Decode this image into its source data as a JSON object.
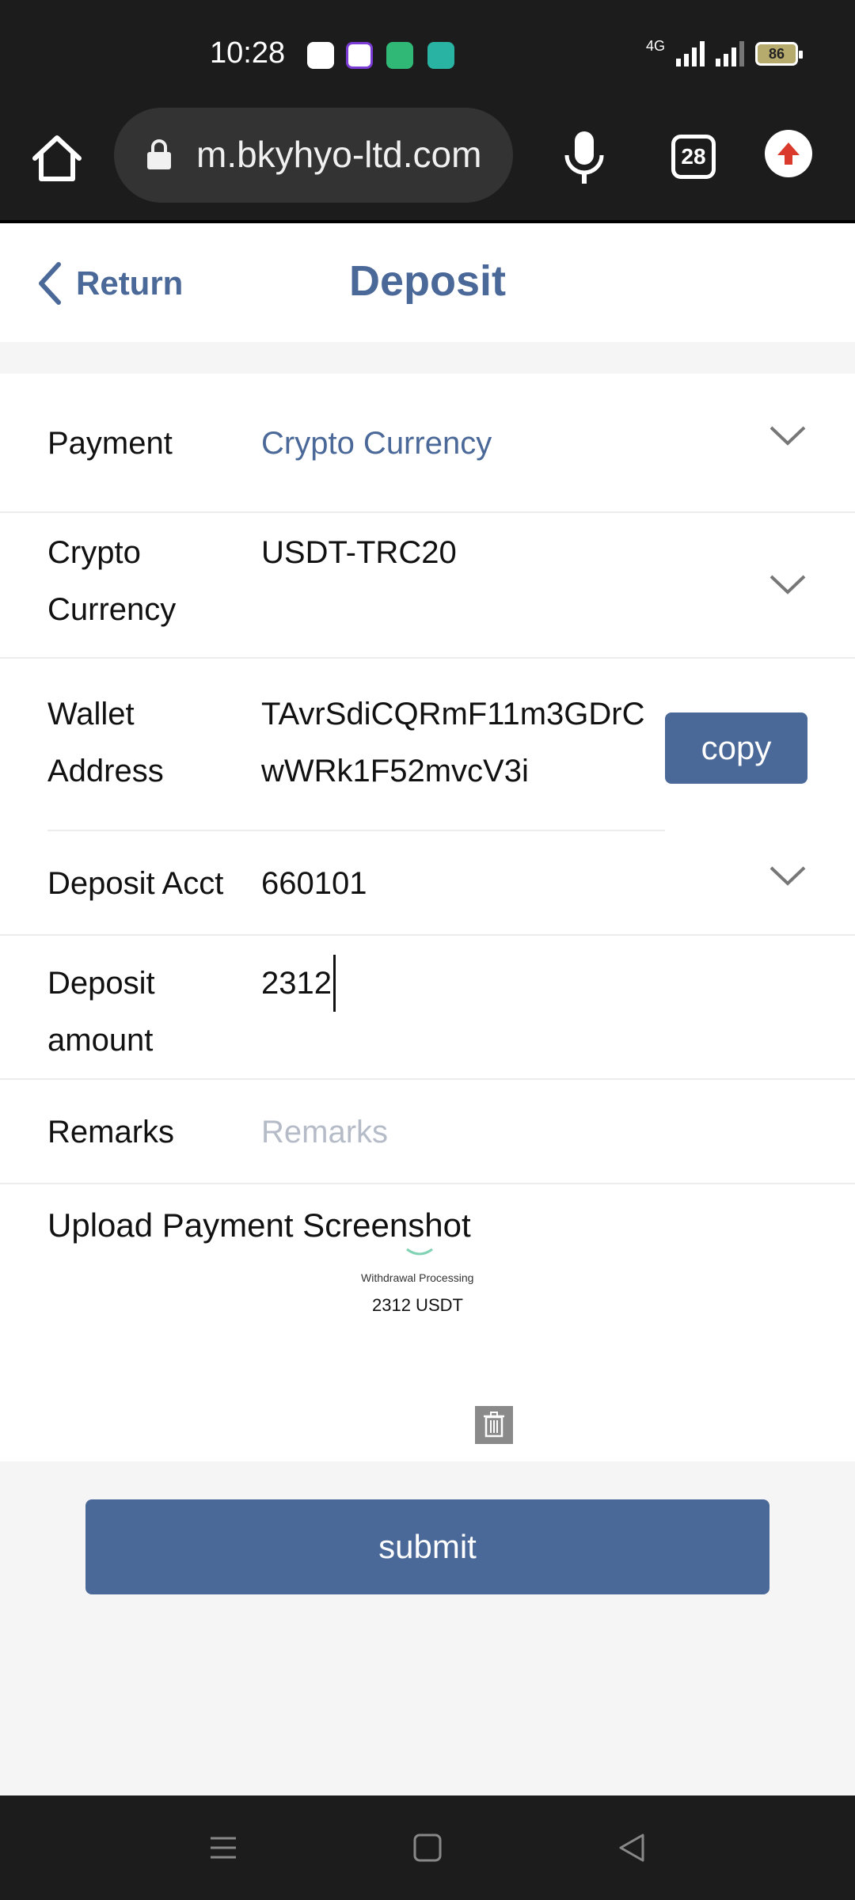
{
  "status_bar": {
    "time": "10:28",
    "network": "4G",
    "battery": "86"
  },
  "browser": {
    "url": "m.bkyhyo-ltd.com",
    "tab_count": "28"
  },
  "header": {
    "return_label": "Return",
    "title": "Deposit"
  },
  "form": {
    "payment": {
      "label": "Payment",
      "value": "Crypto Currency"
    },
    "crypto_currency": {
      "label_line1": "Crypto",
      "label_line2": "Currency",
      "value": "USDT-TRC20"
    },
    "wallet_address": {
      "label_line1": "Wallet",
      "label_line2": "Address",
      "value_line1": "TAvrSdiCQRmF11m3GDrC",
      "value_line2": "wWRk1F52mvcV3i",
      "copy_label": "copy"
    },
    "deposit_acct": {
      "label": "Deposit Acct",
      "value": "660101"
    },
    "deposit_amount": {
      "label_line1": "Deposit",
      "label_line2": "amount",
      "value": "2312"
    },
    "remarks": {
      "label": "Remarks",
      "placeholder": "Remarks"
    },
    "upload": {
      "label": "Upload Payment Screenshot",
      "thumb_caption": "Withdrawal Processing",
      "thumb_amount": "2312 USDT"
    }
  },
  "submit_label": "submit",
  "colors": {
    "accent": "#4a6898",
    "dark_bar": "#1c1c1c",
    "placeholder": "#b5bcc8"
  }
}
